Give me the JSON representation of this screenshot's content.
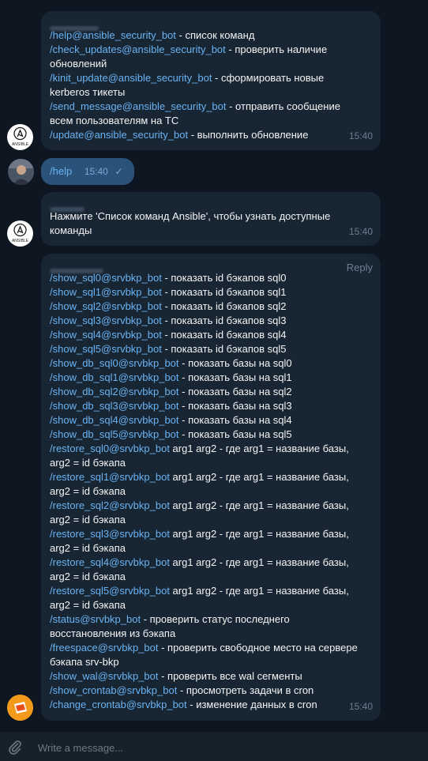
{
  "colors": {
    "background": "#0e1621",
    "incoming_bubble": "#182533",
    "outgoing_bubble": "#2b5278",
    "command_link": "#6ab3f3",
    "timestamp": "#6d7f8f",
    "composer": "#17212b"
  },
  "messages": {
    "m1": {
      "avatar_icon": "ansible-logo-icon",
      "avatar_label": "ANSIBLE",
      "lines": [
        {
          "cmd": "/help@ansible_security_bot",
          "text": " - список команд"
        },
        {
          "cmd": "/check_updates@ansible_security_bot",
          "text": " - проверить наличие"
        },
        {
          "cmd": "",
          "text": "обновлений"
        },
        {
          "cmd": "/kinit_update@ansible_security_bot",
          "text": " - сформировать новые"
        },
        {
          "cmd": "",
          "text": "kerberos тикеты"
        },
        {
          "cmd": "/send_message@ansible_security_bot",
          "text": " - отправить сообщение"
        },
        {
          "cmd": "",
          "text": "всем пользователям на ТС"
        },
        {
          "cmd": "/update@ansible_security_bot",
          "text": " - выполнить обновление"
        }
      ],
      "time": "15:40"
    },
    "m2": {
      "avatar_icon": "user-photo-icon",
      "text": "/help",
      "time": "15:40",
      "status_icon": "double-check-icon"
    },
    "m3": {
      "avatar_icon": "ansible-logo-icon",
      "avatar_label": "ANSIBLE",
      "lines": [
        {
          "cmd": "",
          "text": "Нажмите 'Список команд Ansible', чтобы узнать доступные"
        },
        {
          "cmd": "",
          "text": "команды"
        }
      ],
      "time": "15:40"
    },
    "m4": {
      "avatar_icon": "srvbkp-bot-icon",
      "reply_label": "Reply",
      "lines": [
        {
          "cmd": "/show_sql0@srvbkp_bot",
          "text": " - показать id бэкапов sql0"
        },
        {
          "cmd": "/show_sql1@srvbkp_bot",
          "text": " - показать id бэкапов sql1"
        },
        {
          "cmd": "/show_sql2@srvbkp_bot",
          "text": " - показать id бэкапов sql2"
        },
        {
          "cmd": "/show_sql3@srvbkp_bot",
          "text": " - показать id бэкапов sql3"
        },
        {
          "cmd": "/show_sql4@srvbkp_bot",
          "text": " - показать id бэкапов sql4"
        },
        {
          "cmd": "/show_sql5@srvbkp_bot",
          "text": " - показать id бэкапов sql5"
        },
        {
          "cmd": "/show_db_sql0@srvbkp_bot",
          "text": " - показать базы на sql0"
        },
        {
          "cmd": "/show_db_sql1@srvbkp_bot",
          "text": " - показать базы на sql1"
        },
        {
          "cmd": "/show_db_sql2@srvbkp_bot",
          "text": " - показать базы на sql2"
        },
        {
          "cmd": "/show_db_sql3@srvbkp_bot",
          "text": " - показать базы на sql3"
        },
        {
          "cmd": "/show_db_sql4@srvbkp_bot",
          "text": " - показать базы на sql4"
        },
        {
          "cmd": "/show_db_sql5@srvbkp_bot",
          "text": " - показать базы на sql5"
        },
        {
          "cmd": "/restore_sql0@srvbkp_bot",
          "text": " arg1 arg2 - где arg1 = название базы,"
        },
        {
          "cmd": "",
          "text": "arg2 = id бэкапа"
        },
        {
          "cmd": "/restore_sql1@srvbkp_bot",
          "text": " arg1 arg2 - где arg1 = название базы,"
        },
        {
          "cmd": "",
          "text": "arg2 = id бэкапа"
        },
        {
          "cmd": "/restore_sql2@srvbkp_bot",
          "text": " arg1 arg2 - где arg1 = название базы,"
        },
        {
          "cmd": "",
          "text": "arg2 = id бэкапа"
        },
        {
          "cmd": "/restore_sql3@srvbkp_bot",
          "text": " arg1 arg2 - где arg1 = название базы,"
        },
        {
          "cmd": "",
          "text": "arg2 = id бэкапа"
        },
        {
          "cmd": "/restore_sql4@srvbkp_bot",
          "text": " arg1 arg2 - где arg1 = название базы,"
        },
        {
          "cmd": "",
          "text": "arg2 = id бэкапа"
        },
        {
          "cmd": "/restore_sql5@srvbkp_bot",
          "text": " arg1 arg2 - где arg1 = название базы,"
        },
        {
          "cmd": "",
          "text": "arg2 = id бэкапа"
        },
        {
          "cmd": "/status@srvbkp_bot",
          "text": " - проверить статус последнего"
        },
        {
          "cmd": "",
          "text": "восстановления из бэкапа"
        },
        {
          "cmd": "/freespace@srvbkp_bot",
          "text": " - проверить свободное место на сервере"
        },
        {
          "cmd": "",
          "text": "бэкапа srv-bkp"
        },
        {
          "cmd": "/show_wal@srvbkp_bot",
          "text": " - проверить все wal сегменты"
        },
        {
          "cmd": "/show_crontab@srvbkp_bot",
          "text": " - просмотреть задачи в cron"
        },
        {
          "cmd": "/change_crontab@srvbkp_bot",
          "text": " - изменение данных в cron"
        }
      ],
      "time": "15:40"
    }
  },
  "composer": {
    "placeholder": "Write a message...",
    "value": "",
    "attach_icon": "paperclip-icon"
  }
}
